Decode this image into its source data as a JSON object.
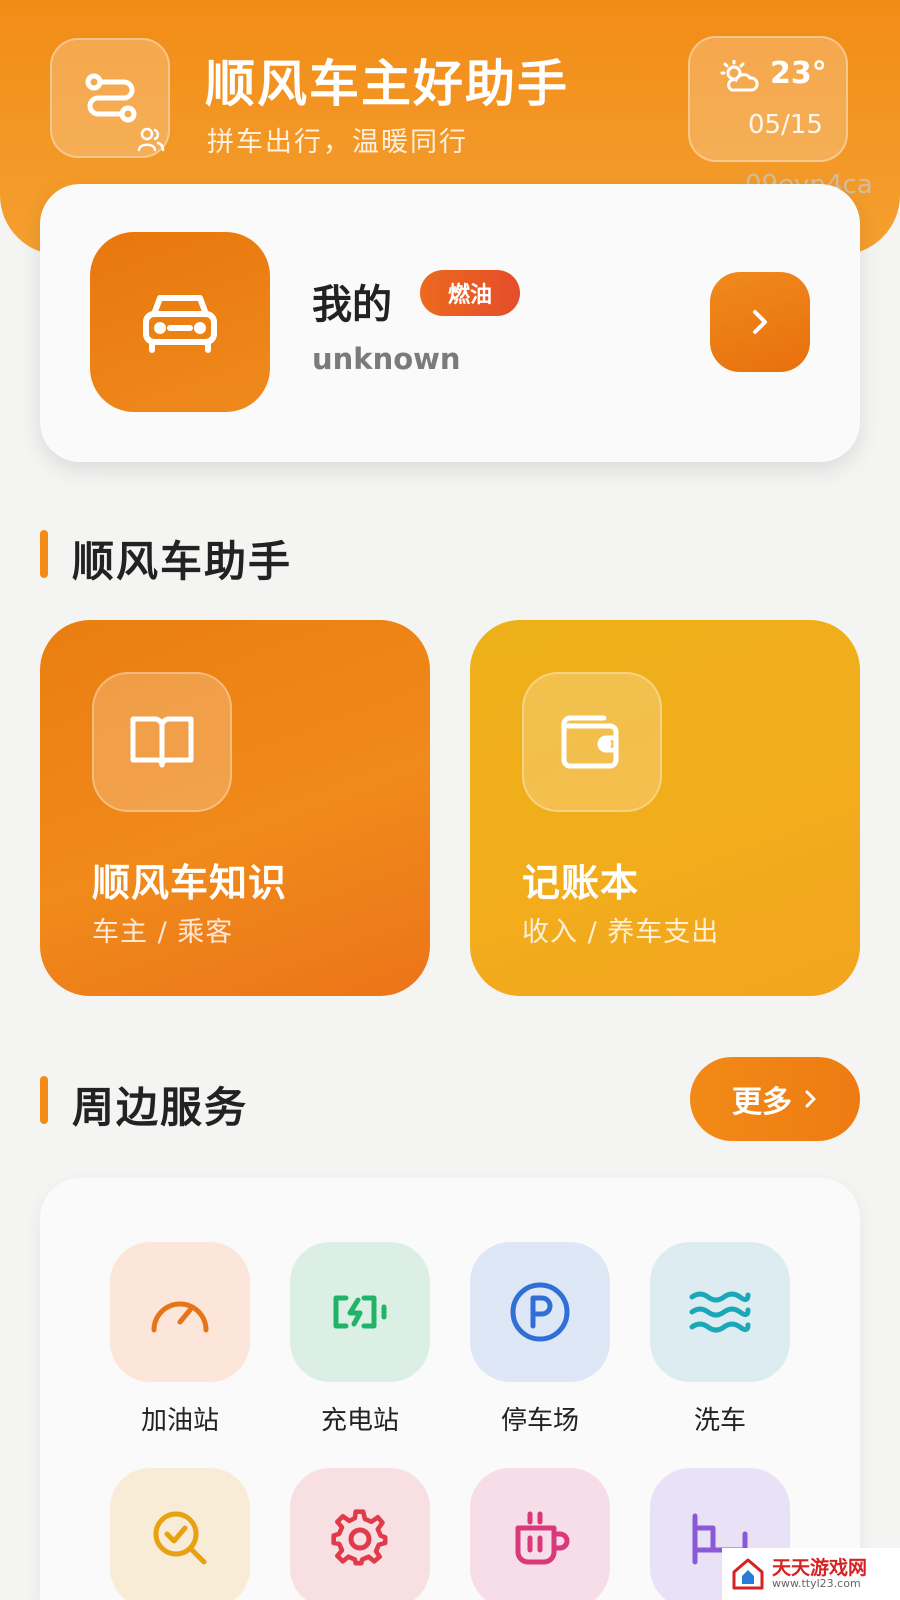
{
  "header": {
    "title": "顺风车主好助手",
    "subtitle": "拼车出行，温暖同行",
    "weather": {
      "temperature": "23°",
      "date": "05/15",
      "icon": "partly-sunny-icon"
    },
    "watermark_id": "09eyn4ca"
  },
  "profile": {
    "name": "我的",
    "badge": "燃油",
    "subtitle": "unknown",
    "avatar_icon": "car-icon",
    "arrow_icon": "chevron-right-icon"
  },
  "assistant": {
    "section_title": "顺风车助手",
    "cards": [
      {
        "title": "顺风车知识",
        "subtitle": "车主 / 乘客",
        "icon": "book-icon"
      },
      {
        "title": "记账本",
        "subtitle": "收入 / 养车支出",
        "icon": "wallet-icon"
      }
    ]
  },
  "services": {
    "section_title": "周边服务",
    "more_label": "更多",
    "items": [
      {
        "label": "加油站",
        "icon": "speedometer-icon",
        "color": "#e5751a",
        "bg": "#fbe6d9"
      },
      {
        "label": "充电站",
        "icon": "charging-battery-icon",
        "color": "#22b36a",
        "bg": "#dcefe5"
      },
      {
        "label": "停车场",
        "icon": "parking-icon",
        "color": "#2f6fd6",
        "bg": "#dde7f6"
      },
      {
        "label": "洗车",
        "icon": "waves-icon",
        "color": "#1aa8b8",
        "bg": "#dcecf1"
      },
      {
        "label": "",
        "icon": "search-check-icon",
        "color": "#e9a114",
        "bg": "#f8ecd6"
      },
      {
        "label": "",
        "icon": "gear-icon",
        "color": "#df3b4b",
        "bg": "#f7dfe2"
      },
      {
        "label": "",
        "icon": "coffee-cup-icon",
        "color": "#d9397a",
        "bg": "#f7dde8"
      },
      {
        "label": "",
        "icon": "bed-icon",
        "color": "#8a5ad6",
        "bg": "#e9e2f6"
      }
    ]
  },
  "corner_watermark": {
    "name": "天天游戏网",
    "url": "www.ttyl23.com"
  },
  "colors": {
    "accent": "#f28c17",
    "knowledge_card": "#ec7a12",
    "ledger_card": "#f0ae1a",
    "badge": "#e85a24"
  }
}
